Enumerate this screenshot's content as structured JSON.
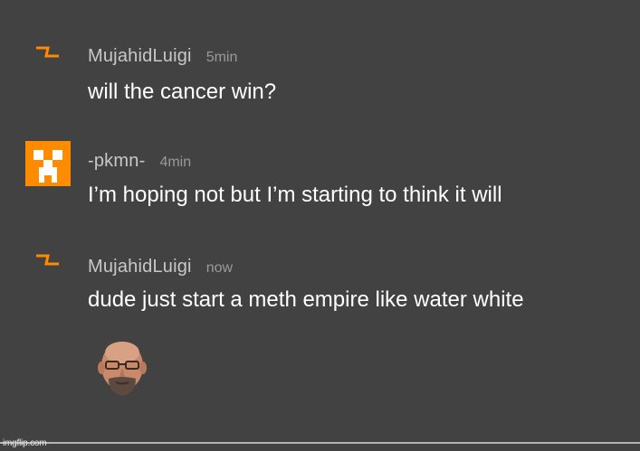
{
  "colors": {
    "background": "#424242",
    "username": "#c8c8c8",
    "timestamp": "#9a9a9a",
    "message": "#ffffff",
    "accent_orange": "#ff8a00"
  },
  "comments": [
    {
      "avatar_icon": "lightning-icon",
      "username": "MujahidLuigi",
      "time": "5min",
      "text": "will the cancer win?"
    },
    {
      "avatar_icon": "creeper-face-icon",
      "username": "-pkmn-",
      "time": "4min",
      "text": "I’m hoping not but I’m starting to think it will"
    },
    {
      "avatar_icon": "lightning-icon",
      "username": "MujahidLuigi",
      "time": "now",
      "text": "dude just start a meth empire like water white"
    }
  ],
  "reaction_image": "bald-man-face-icon",
  "watermark": "imgflip.com"
}
